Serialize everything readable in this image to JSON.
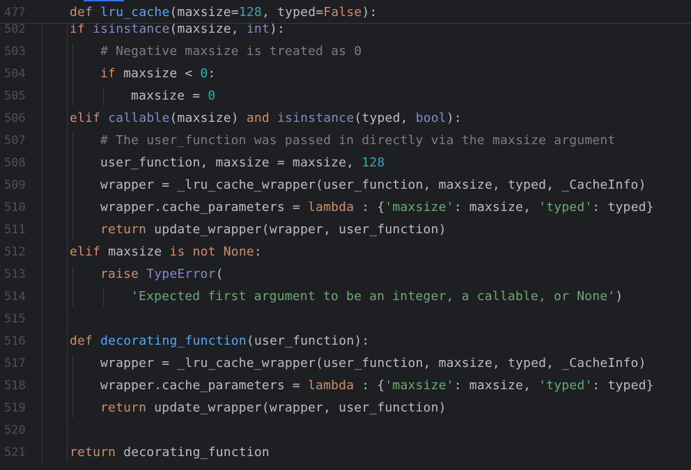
{
  "colors": {
    "background": "#1e1f22",
    "keyword": "#cf8e6d",
    "function": "#56a8f5",
    "builtin": "#8888c6",
    "number": "#2aacb8",
    "string": "#6aab73",
    "comment": "#7a7e85",
    "text": "#bcbec4",
    "line_number": "#4b5059"
  },
  "sticky_line": {
    "number": "477",
    "tokens": [
      {
        "t": "kw",
        "v": "def "
      },
      {
        "t": "fn",
        "v": "lru_cache"
      },
      {
        "t": "tx",
        "v": "(maxsize="
      },
      {
        "t": "num",
        "v": "128"
      },
      {
        "t": "tx",
        "v": ", typed="
      },
      {
        "t": "kw",
        "v": "False"
      },
      {
        "t": "tx",
        "v": "):"
      }
    ]
  },
  "lines": [
    {
      "number": "502",
      "indent": 2,
      "tokens": [
        {
          "t": "kw",
          "v": "if "
        },
        {
          "t": "bi",
          "v": "isinstance"
        },
        {
          "t": "tx",
          "v": "(maxsize, "
        },
        {
          "t": "bi",
          "v": "int"
        },
        {
          "t": "tx",
          "v": "):"
        }
      ]
    },
    {
      "number": "503",
      "indent": 3,
      "tokens": [
        {
          "t": "cm",
          "v": "# Negative maxsize is treated as 0"
        }
      ]
    },
    {
      "number": "504",
      "indent": 3,
      "tokens": [
        {
          "t": "kw",
          "v": "if "
        },
        {
          "t": "tx",
          "v": "maxsize < "
        },
        {
          "t": "num",
          "v": "0"
        },
        {
          "t": "tx",
          "v": ":"
        }
      ]
    },
    {
      "number": "505",
      "indent": 4,
      "tokens": [
        {
          "t": "tx",
          "v": "maxsize = "
        },
        {
          "t": "num",
          "v": "0"
        }
      ]
    },
    {
      "number": "506",
      "indent": 2,
      "tokens": [
        {
          "t": "kw",
          "v": "elif "
        },
        {
          "t": "bi",
          "v": "callable"
        },
        {
          "t": "tx",
          "v": "(maxsize) "
        },
        {
          "t": "kw",
          "v": "and "
        },
        {
          "t": "bi",
          "v": "isinstance"
        },
        {
          "t": "tx",
          "v": "(typed, "
        },
        {
          "t": "bi",
          "v": "bool"
        },
        {
          "t": "tx",
          "v": "):"
        }
      ]
    },
    {
      "number": "507",
      "indent": 3,
      "tokens": [
        {
          "t": "cm",
          "v": "# The user_function was passed in directly via the maxsize argument"
        }
      ]
    },
    {
      "number": "508",
      "indent": 3,
      "tokens": [
        {
          "t": "tx",
          "v": "user_function, maxsize = maxsize, "
        },
        {
          "t": "num",
          "v": "128"
        }
      ]
    },
    {
      "number": "509",
      "indent": 3,
      "tokens": [
        {
          "t": "tx",
          "v": "wrapper = _lru_cache_wrapper(user_function, maxsize, typed, _CacheInfo)"
        }
      ]
    },
    {
      "number": "510",
      "indent": 3,
      "tokens": [
        {
          "t": "tx",
          "v": "wrapper.cache_parameters = "
        },
        {
          "t": "kw",
          "v": "lambda"
        },
        {
          "t": "tx",
          "v": " : {"
        },
        {
          "t": "str",
          "v": "'maxsize'"
        },
        {
          "t": "tx",
          "v": ": maxsize, "
        },
        {
          "t": "str",
          "v": "'typed'"
        },
        {
          "t": "tx",
          "v": ": typed}"
        }
      ]
    },
    {
      "number": "511",
      "indent": 3,
      "tokens": [
        {
          "t": "kw",
          "v": "return "
        },
        {
          "t": "tx",
          "v": "update_wrapper(wrapper, user_function)"
        }
      ]
    },
    {
      "number": "512",
      "indent": 2,
      "tokens": [
        {
          "t": "kw",
          "v": "elif "
        },
        {
          "t": "tx",
          "v": "maxsize "
        },
        {
          "t": "kw",
          "v": "is not None"
        },
        {
          "t": "tx",
          "v": ":"
        }
      ]
    },
    {
      "number": "513",
      "indent": 3,
      "tokens": [
        {
          "t": "kw",
          "v": "raise "
        },
        {
          "t": "bi",
          "v": "TypeError"
        },
        {
          "t": "tx",
          "v": "("
        }
      ]
    },
    {
      "number": "514",
      "indent": 4,
      "tokens": [
        {
          "t": "str",
          "v": "'Expected first argument to be an integer, a callable, or None'"
        },
        {
          "t": "tx",
          "v": ")"
        }
      ]
    },
    {
      "number": "515",
      "indent": 0,
      "tokens": []
    },
    {
      "number": "516",
      "indent": 2,
      "tokens": [
        {
          "t": "kw",
          "v": "def "
        },
        {
          "t": "fn",
          "v": "decorating_function"
        },
        {
          "t": "tx",
          "v": "(user_function):"
        }
      ]
    },
    {
      "number": "517",
      "indent": 3,
      "tokens": [
        {
          "t": "tx",
          "v": "wrapper = _lru_cache_wrapper(user_function, maxsize, typed, _CacheInfo)"
        }
      ]
    },
    {
      "number": "518",
      "indent": 3,
      "tokens": [
        {
          "t": "tx",
          "v": "wrapper.cache_parameters = "
        },
        {
          "t": "kw",
          "v": "lambda"
        },
        {
          "t": "tx",
          "v": " : {"
        },
        {
          "t": "str",
          "v": "'maxsize'"
        },
        {
          "t": "tx",
          "v": ": maxsize, "
        },
        {
          "t": "str",
          "v": "'typed'"
        },
        {
          "t": "tx",
          "v": ": typed}"
        }
      ]
    },
    {
      "number": "519",
      "indent": 3,
      "tokens": [
        {
          "t": "kw",
          "v": "return "
        },
        {
          "t": "tx",
          "v": "update_wrapper(wrapper, user_function)"
        }
      ]
    },
    {
      "number": "520",
      "indent": 0,
      "tokens": []
    },
    {
      "number": "521",
      "indent": 2,
      "tokens": [
        {
          "t": "kw",
          "v": "return "
        },
        {
          "t": "tx",
          "v": "decorating_function"
        }
      ]
    }
  ]
}
